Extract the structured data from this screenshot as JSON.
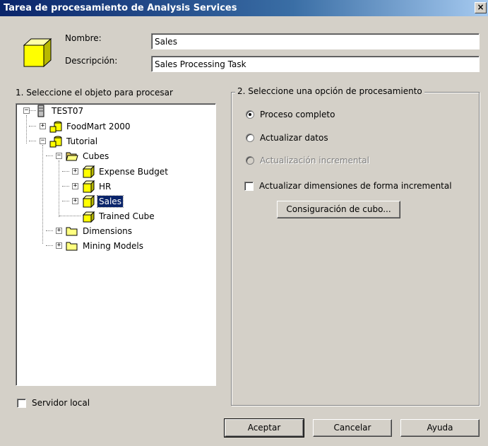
{
  "window": {
    "title": "Tarea de procesamiento de Analysis Services",
    "close_label": "×"
  },
  "form": {
    "name_label": "Nombre:",
    "name_value": "Sales",
    "description_label": "Descripción:",
    "description_value": "Sales Processing Task"
  },
  "tree": {
    "section_label": "1. Seleccione el objeto para procesar",
    "nodes": [
      {
        "label": "TEST07",
        "icon": "server-icon",
        "expander": "−"
      },
      {
        "label": "FoodMart 2000",
        "icon": "database-icon",
        "expander": "+"
      },
      {
        "label": "Tutorial",
        "icon": "database-icon",
        "expander": "−"
      },
      {
        "label": "Cubes",
        "icon": "folder-open-icon",
        "expander": "−"
      },
      {
        "label": "Expense Budget",
        "icon": "cube-icon",
        "expander": "+"
      },
      {
        "label": "HR",
        "icon": "cube-icon",
        "expander": "+"
      },
      {
        "label": "Sales",
        "icon": "cube-icon",
        "expander": "+",
        "selected": true
      },
      {
        "label": "Trained Cube",
        "icon": "virtual-cube-icon"
      },
      {
        "label": "Dimensions",
        "icon": "folder-icon",
        "expander": "+"
      },
      {
        "label": "Mining Models",
        "icon": "folder-icon",
        "expander": "+"
      }
    ]
  },
  "options": {
    "section_label": "2. Seleccione una opción de procesamiento",
    "full_process": "Proceso completo",
    "refresh_data": "Actualizar datos",
    "incremental_update": "Actualización incremental",
    "incremental_dimensions": "Actualizar dimensiones de forma incremental",
    "cube_settings_button": "Consiguración de cubo..."
  },
  "local_server_label": "Servidor local",
  "buttons": {
    "ok": "Aceptar",
    "cancel": "Cancelar",
    "help": "Ayuda"
  },
  "colors": {
    "title_bar": "#0a246a",
    "dialog_bg": "#d4d0c8",
    "selection": "#0a246a",
    "folder_yellow": "#ffff00"
  }
}
